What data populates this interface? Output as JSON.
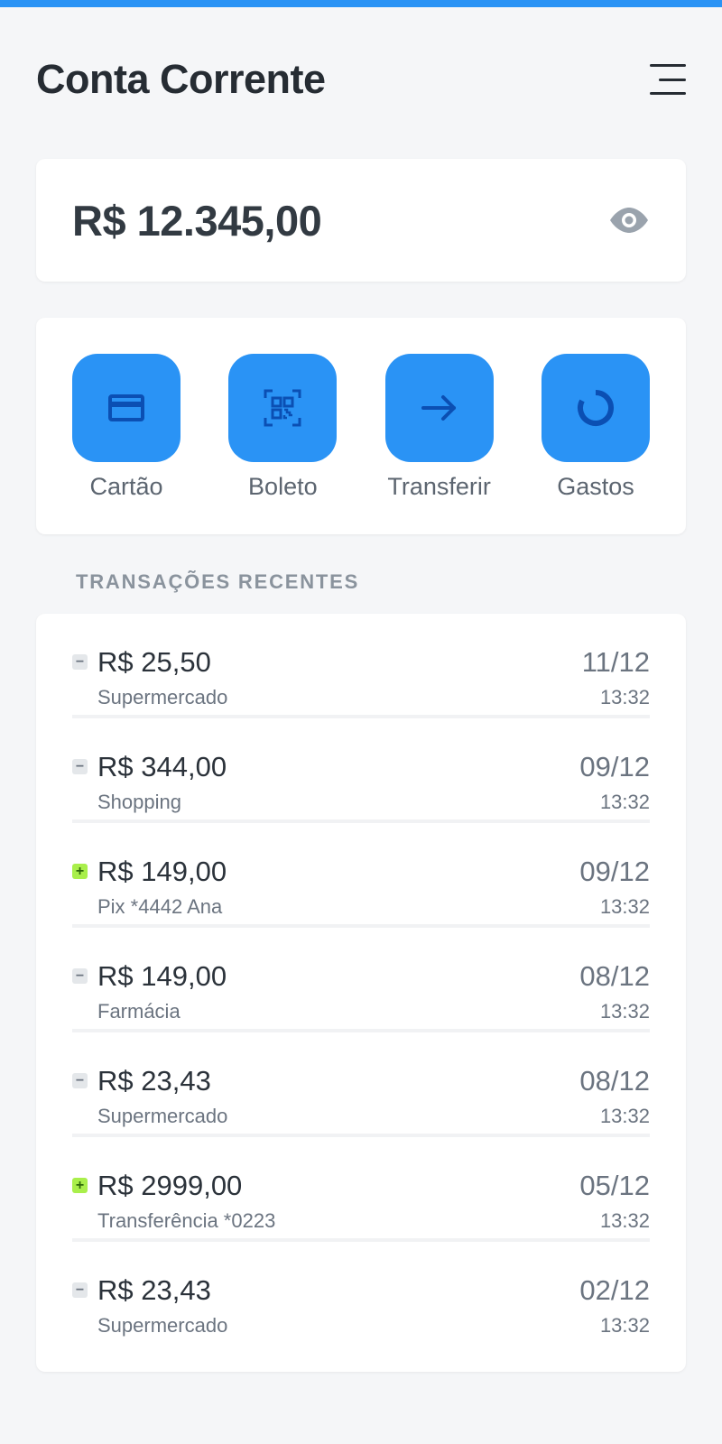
{
  "header": {
    "title": "Conta Corrente",
    "menu_icon": "menu-icon"
  },
  "balance": {
    "amount": "R$ 12.345,00",
    "visibility_icon": "eye-icon"
  },
  "actions": [
    {
      "label": "Cartão",
      "icon": "card-icon"
    },
    {
      "label": "Boleto",
      "icon": "qr-code-icon"
    },
    {
      "label": "Transferir",
      "icon": "arrow-right-icon"
    },
    {
      "label": "Gastos",
      "icon": "donut-chart-icon"
    }
  ],
  "transactions": {
    "title": "TRANSAÇÕES RECENTES",
    "items": [
      {
        "sign": "−",
        "type": "out",
        "amount": "R$ 25,50",
        "description": "Supermercado",
        "date": "11/12",
        "time": "13:32"
      },
      {
        "sign": "−",
        "type": "out",
        "amount": "R$ 344,00",
        "description": "Shopping",
        "date": "09/12",
        "time": "13:32"
      },
      {
        "sign": "+",
        "type": "in",
        "amount": "R$ 149,00",
        "description": "Pix *4442 Ana",
        "date": "09/12",
        "time": "13:32"
      },
      {
        "sign": "−",
        "type": "out",
        "amount": "R$ 149,00",
        "description": "Farmácia",
        "date": "08/12",
        "time": "13:32"
      },
      {
        "sign": "−",
        "type": "out",
        "amount": "R$ 23,43",
        "description": "Supermercado",
        "date": "08/12",
        "time": "13:32"
      },
      {
        "sign": "+",
        "type": "in",
        "amount": "R$ 2999,00",
        "description": "Transferência *0223",
        "date": "05/12",
        "time": "13:32"
      },
      {
        "sign": "−",
        "type": "out",
        "amount": "R$ 23,43",
        "description": "Supermercado",
        "date": "02/12",
        "time": "13:32"
      }
    ]
  },
  "colors": {
    "accent": "#2a93f5",
    "icon_dark": "#0b4fb3",
    "income_badge": "#a9ef4b",
    "expense_badge": "#e4e7ea",
    "background": "#f5f6f8"
  }
}
